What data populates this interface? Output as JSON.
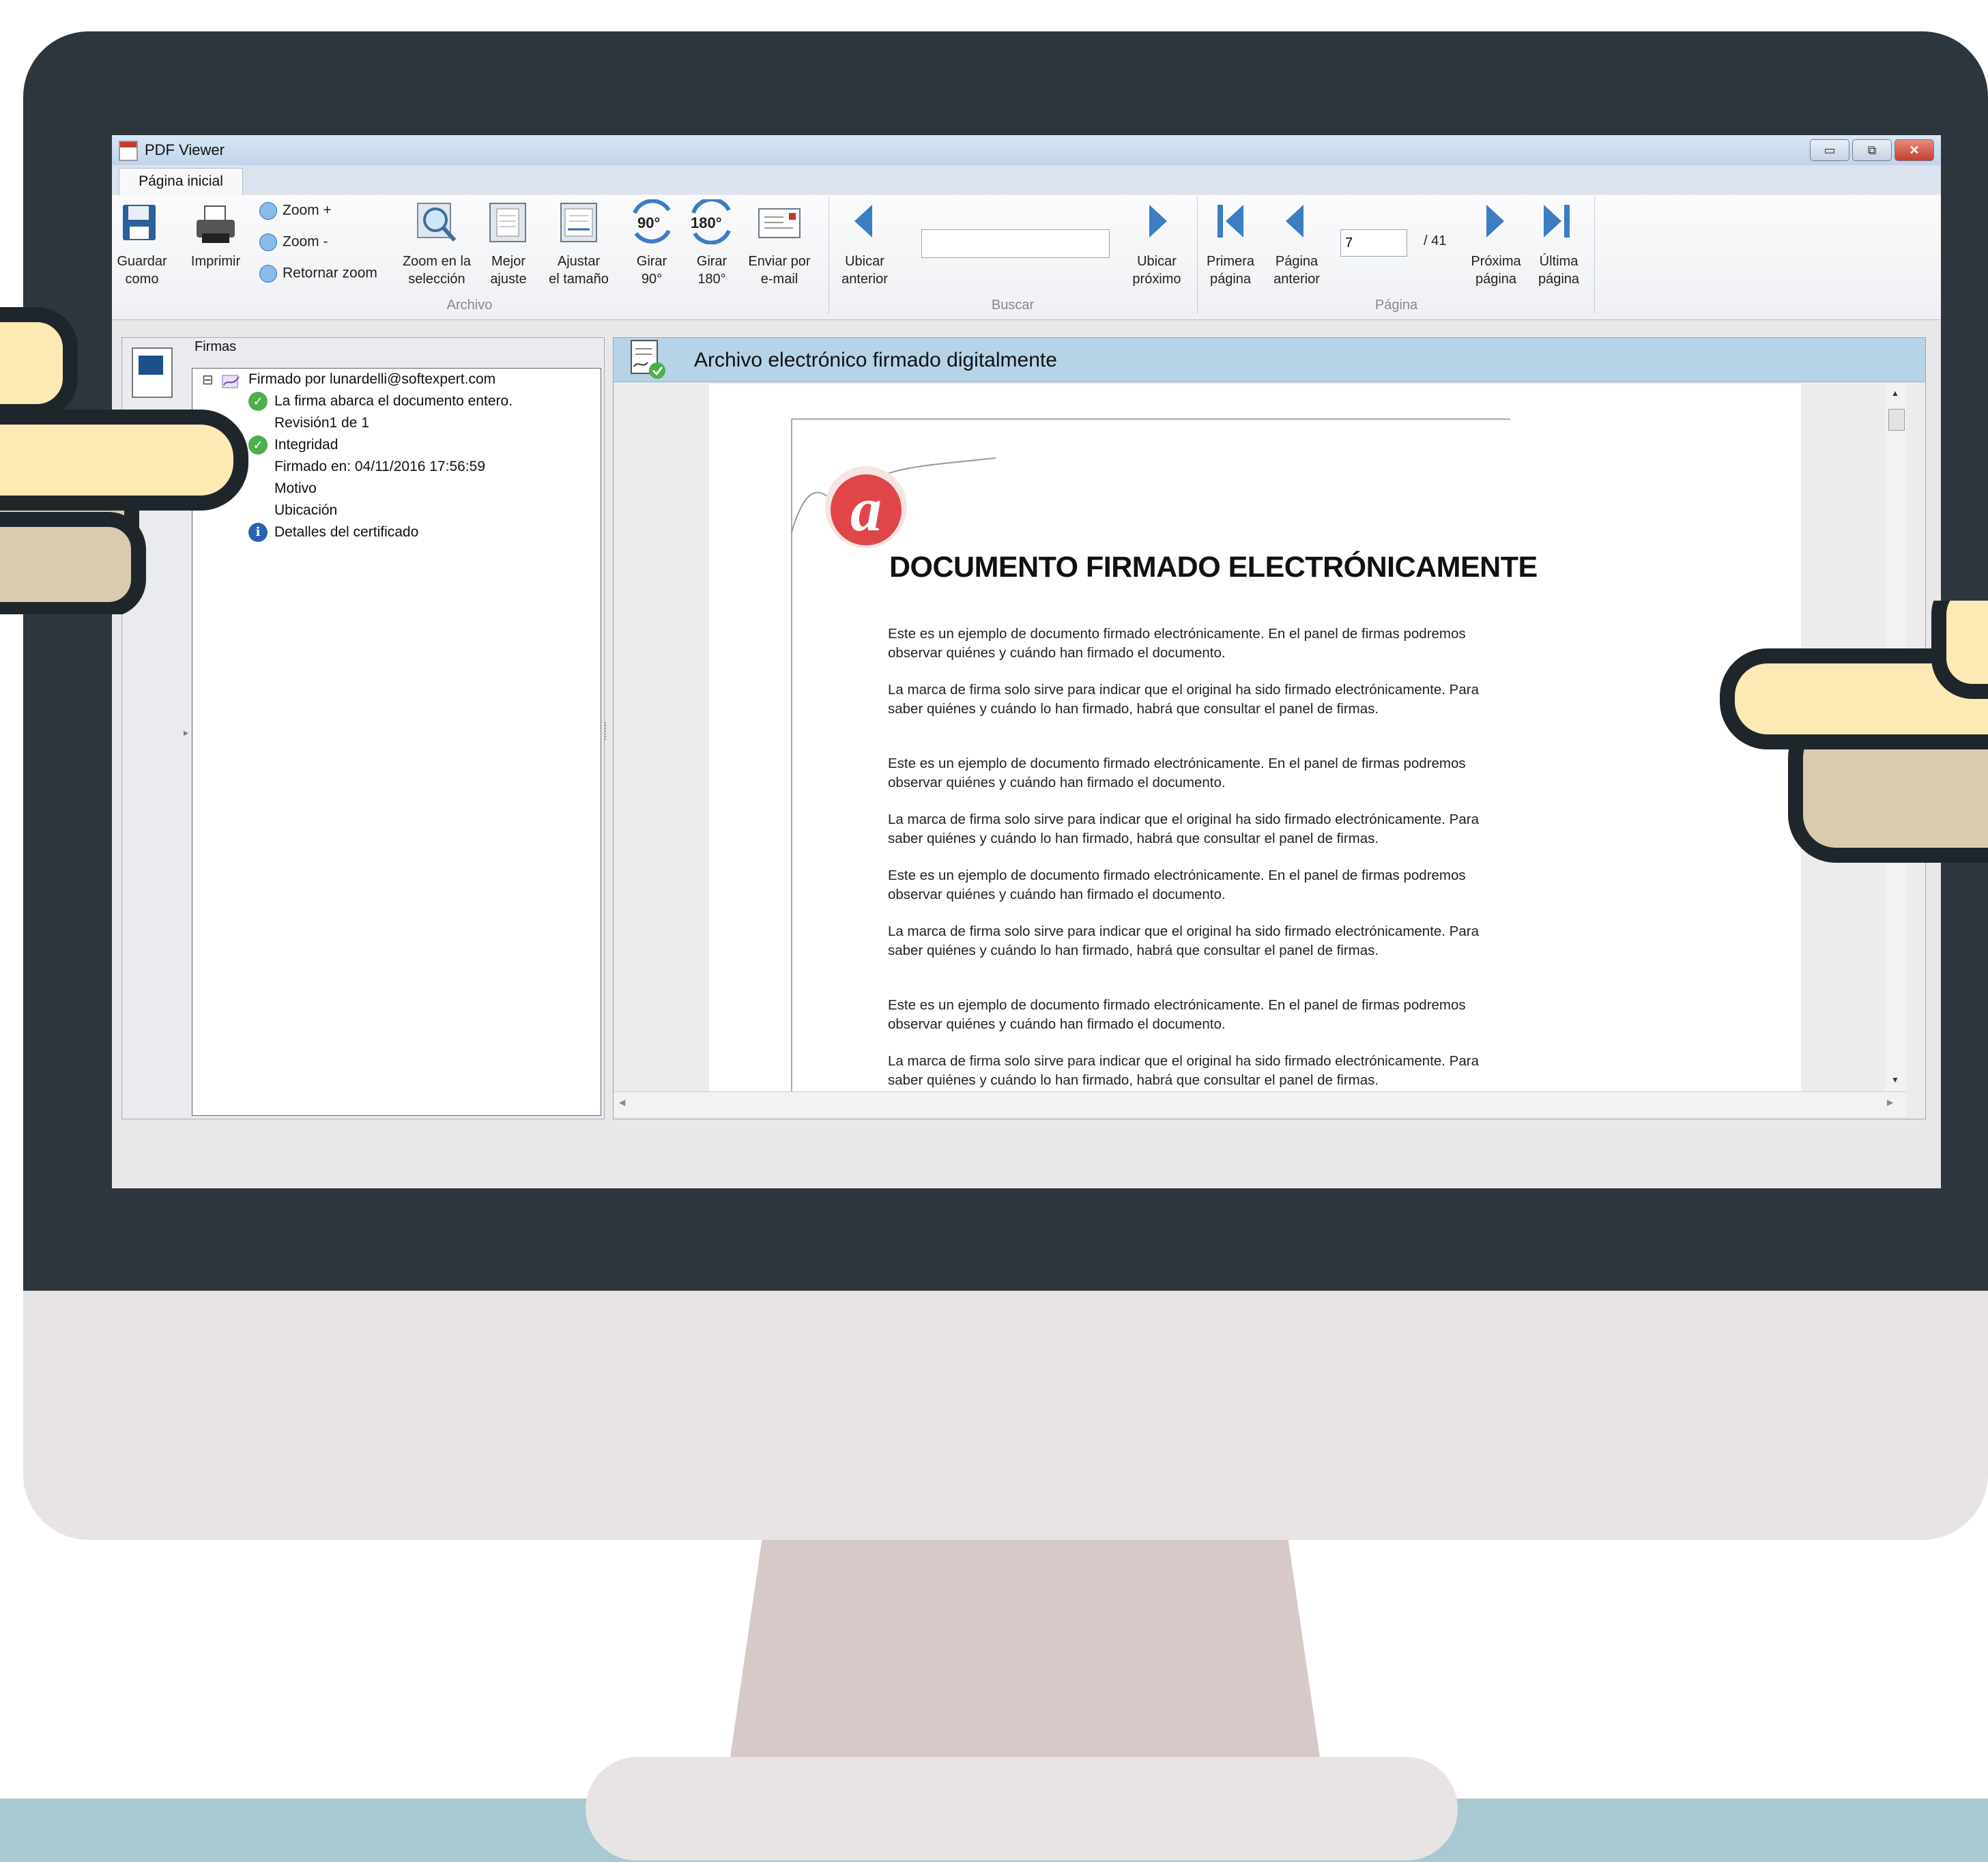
{
  "window": {
    "title": "PDF Viewer",
    "controls": [
      "▭",
      "⧉",
      "✕"
    ]
  },
  "tabs": [
    {
      "label": "Página inicial",
      "active": true
    }
  ],
  "ribbon": {
    "archivo": {
      "group_label": "Archivo",
      "save_label": "Guardar\ncomo",
      "print_label": "Imprimir",
      "zoom_in_label": "Zoom +",
      "zoom_out_label": "Zoom -",
      "zoom_reset_label": "Retornar zoom",
      "zoom_selection_label": "Zoom en la\nselección",
      "best_fit_label": "Mejor\najuste",
      "fit_size_label": "Ajustar\nel tamaño",
      "rotate90_label": "Girar\n90°",
      "rotate180_label": "Girar\n180°",
      "rotate90_icon_text": "90°",
      "rotate180_icon_text": "180°",
      "email_label": "Enviar por\ne-mail"
    },
    "buscar": {
      "group_label": "Buscar",
      "prev_label": "Ubicar\nanterior",
      "next_label": "Ubicar\npróximo",
      "search_value": ""
    },
    "pagina": {
      "group_label": "Página",
      "first_label": "Primera\npágina",
      "prev_label": "Página\nanterior",
      "current_page": "7",
      "total_pages": "/ 41",
      "next_label": "Próxima\npágina",
      "last_label": "Última\npágina"
    }
  },
  "signatures_panel": {
    "heading": "Firmas",
    "tree": {
      "expander": "⊟",
      "signer": "Firmado por lunardelli@softexpert.com",
      "items": [
        {
          "text": "La firma abarca el documento entero.",
          "icon": "check-icon"
        },
        {
          "text": "Revisión1 de 1",
          "icon": ""
        },
        {
          "text": "Integridad",
          "icon": "check-icon"
        },
        {
          "text": "Firmado en: 04/11/2016 17:56:59",
          "icon": ""
        },
        {
          "text": "Motivo",
          "icon": ""
        },
        {
          "text": "Ubicación",
          "icon": ""
        },
        {
          "text": "Detalles del certificado",
          "icon": "info-icon"
        }
      ]
    }
  },
  "viewer": {
    "header_title": "Archivo electrónico firmado digitalmente",
    "document": {
      "logo_letter": "a",
      "heading": "DOCUMENTO FIRMADO ELECTRÓNICAMENTE",
      "paragraphs": [
        "Este es un ejemplo de documento firmado electrónicamente. En el panel de firmas podremos observar quiénes y cuándo han firmado el documento.",
        "La marca de firma solo sirve para indicar que el original ha sido firmado electrónicamente. Para saber quiénes y cuándo lo han firmado, habrá que consultar el panel de firmas.",
        "Este es un ejemplo de documento firmado electrónicamente. En el panel de firmas podremos observar quiénes y cuándo han firmado el documento.",
        "La marca de firma solo sirve para indicar que el original ha sido firmado electrónicamente. Para saber quiénes y cuándo lo han firmado, habrá que consultar el panel de firmas.",
        "Este es un ejemplo de documento firmado electrónicamente. En el panel de firmas podremos observar quiénes y cuándo han firmado el documento.",
        "La marca de firma solo sirve para indicar que el original ha sido firmado electrónicamente. Para saber quiénes y cuándo lo han firmado, habrá que consultar el panel de firmas.",
        "Este es un ejemplo de documento firmado electrónicamente. En el panel de firmas podremos observar quiénes y cuándo han firmado el documento.",
        "La marca de firma solo sirve para indicar que el original ha sido firmado electrónicamente. Para saber quiénes y cuándo lo han firmado, habrá que consultar el panel de firmas."
      ]
    }
  },
  "colors": {
    "bezel": "#2e363d",
    "chin": "#e8e4e3",
    "stand": "#d6c9c7",
    "band": "#a8c9d1",
    "viewer_header": "#b6d3e8",
    "accent_blue": "#3c7dc4",
    "logo_red": "#e0454a"
  }
}
